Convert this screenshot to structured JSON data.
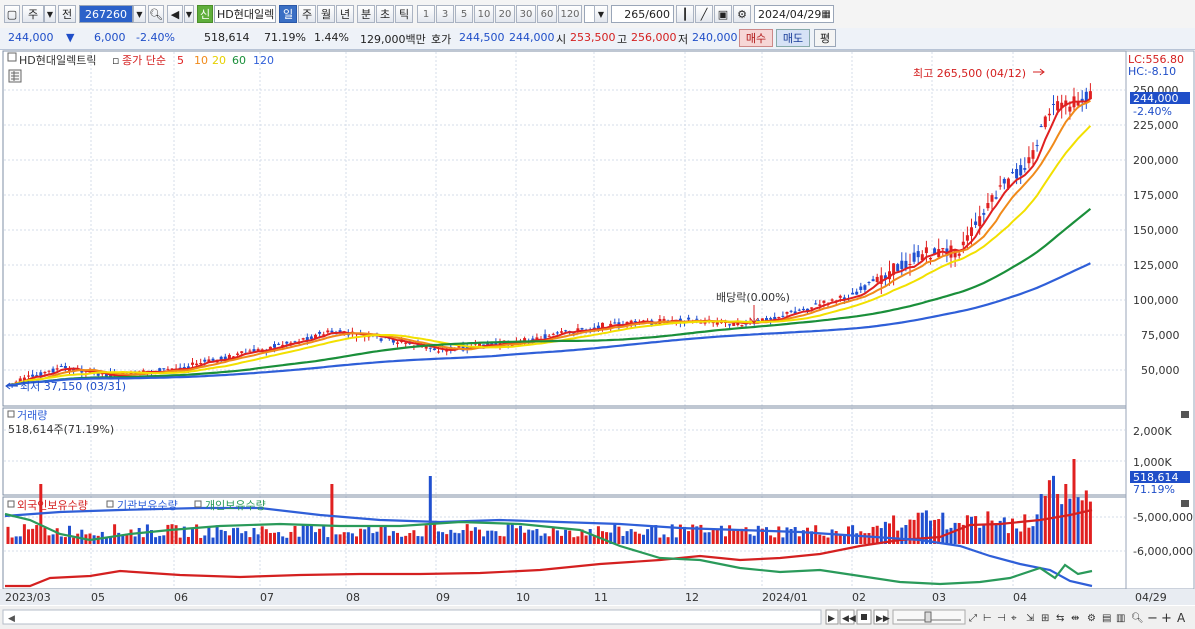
{
  "toolbar": {
    "market_btn": "주",
    "prev_btn": "전",
    "code": "267260",
    "stock_tag": "신",
    "stock_name": "HD현대일렉",
    "periods": [
      {
        "label": "일",
        "selected": true
      },
      {
        "label": "주",
        "selected": false
      },
      {
        "label": "월",
        "selected": false
      },
      {
        "label": "년",
        "selected": false
      },
      {
        "label": "분",
        "selected": false
      },
      {
        "label": "초",
        "selected": false
      },
      {
        "label": "틱",
        "selected": false
      }
    ],
    "intervals": [
      "1",
      "3",
      "5",
      "10",
      "20",
      "30",
      "60",
      "120"
    ],
    "count": "265",
    "count_total": "/600",
    "date": "2024/04/29"
  },
  "quote": {
    "price": "244,000",
    "direction_arrow": "▼",
    "change": "6,000",
    "change_pct": "-2.40%",
    "volume": "518,614",
    "volume_ratio": "71.19%",
    "turnover": "1.44%",
    "amount": "129,000백만",
    "hoga_label": "호가",
    "ask": "244,500",
    "bid": "244,000",
    "open_label": "시",
    "open": "253,500",
    "high_label": "고",
    "high": "256,000",
    "low_label": "저",
    "low": "240,000",
    "buy_label": "매수",
    "sell_label": "매도",
    "eval_label": "평"
  },
  "price_panel": {
    "legend_stock": "HD현대일렉트릭",
    "legend_ma_title": "종가 단순",
    "ma": [
      {
        "period": "5",
        "color": "#e02020"
      },
      {
        "period": "10",
        "color": "#f08a1a"
      },
      {
        "period": "20",
        "color": "#f2e000"
      },
      {
        "period": "60",
        "color": "#1a8f3a"
      },
      {
        "period": "120",
        "color": "#2f5fd8"
      }
    ],
    "lc_label": "LC:556.80",
    "hc_label": "HC:-8.10",
    "current_price_tag": "244,000",
    "current_pct_tag": "-2.40%",
    "high_annotation": "최고 265,500 (04/12)",
    "low_annotation": "최저 37,150 (03/31)",
    "dividend_annotation": "배당락(0.00%)",
    "y_ticks": [
      "250,000",
      "225,000",
      "200,000",
      "175,000",
      "150,000",
      "125,000",
      "100,000",
      "75,000",
      "50,000"
    ]
  },
  "volume_panel": {
    "title": "거래량",
    "value_label": "518,614주(71.19%)",
    "y_ticks": [
      "2,000K",
      "1,000K"
    ],
    "current_tag": "518,614",
    "current_pct_tag": "71.19%"
  },
  "holdings_panel": {
    "series": [
      {
        "name": "외국인보유수량",
        "color": "#d42020"
      },
      {
        "name": "기관보유수량",
        "color": "#2f5fd8"
      },
      {
        "name": "개인보유수량",
        "color": "#2a9a5a"
      }
    ],
    "y_ticks": [
      "-5,000,000",
      "-6,000,000"
    ]
  },
  "x_axis": {
    "labels": [
      "2023/03",
      "05",
      "06",
      "07",
      "08",
      "09",
      "10",
      "11",
      "12",
      "2024/01",
      "02",
      "03",
      "04"
    ],
    "end_label": "04/29"
  },
  "colors": {
    "up": "#e02020",
    "down": "#2050d0",
    "grid": "#c8d2e0",
    "panel_border": "#7f8fa6"
  }
}
